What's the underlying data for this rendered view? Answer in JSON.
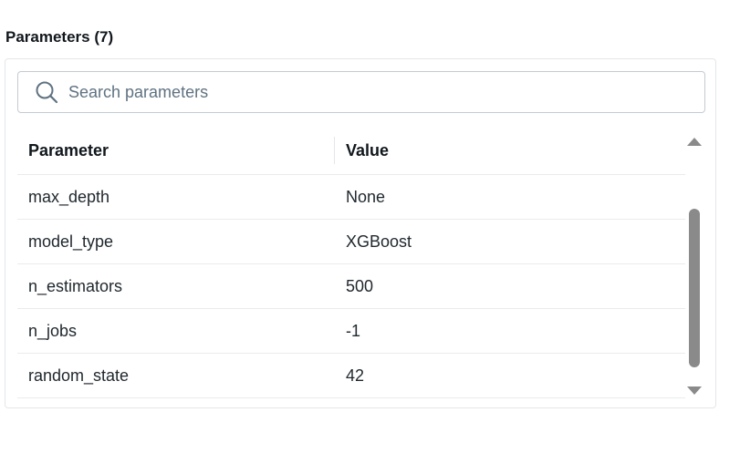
{
  "section": {
    "title": "Parameters (7)"
  },
  "search": {
    "placeholder": "Search parameters",
    "value": ""
  },
  "table": {
    "headers": {
      "parameter": "Parameter",
      "value": "Value"
    },
    "rows": [
      {
        "parameter": "max_depth",
        "value": "None"
      },
      {
        "parameter": "model_type",
        "value": "XGBoost"
      },
      {
        "parameter": "n_estimators",
        "value": "500"
      },
      {
        "parameter": "n_jobs",
        "value": "-1"
      },
      {
        "parameter": "random_state",
        "value": "42"
      }
    ]
  },
  "icons": {
    "search": "search-icon",
    "scroll_up": "arrow-up-icon",
    "scroll_down": "arrow-down-icon"
  }
}
